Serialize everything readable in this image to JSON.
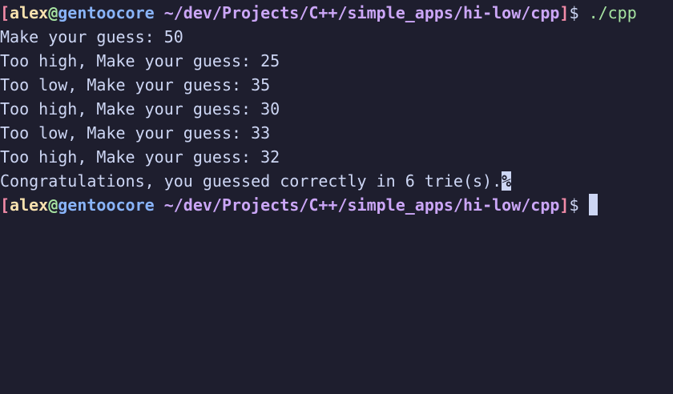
{
  "colors": {
    "background": "#1e1e2e",
    "foreground": "#cdd6f4",
    "bracket": "#f38ba8",
    "user": "#f9e2af",
    "at": "#a6e3a1",
    "host": "#89b4fa",
    "path": "#cba6f7",
    "command": "#a6e3a1"
  },
  "prompt": {
    "open_bracket": "[",
    "user": "alex",
    "at": "@",
    "host": "gentoocore",
    "path": " ~/dev/Projects/C++/simple_apps/hi-low/cpp",
    "close_bracket": "]",
    "dollar": "$ "
  },
  "command": "./cpp",
  "output_lines": [
    "Make your guess: 50",
    "Too high, Make your guess: 25",
    "Too low, Make your guess: 35",
    "Too high, Make your guess: 30",
    "Too low, Make your guess: 33",
    "Too high, Make your guess: 32",
    "Congratulations, you guessed correctly in 6 trie(s)."
  ],
  "no_newline_marker": "%",
  "cursor_icon": "block-cursor-icon"
}
